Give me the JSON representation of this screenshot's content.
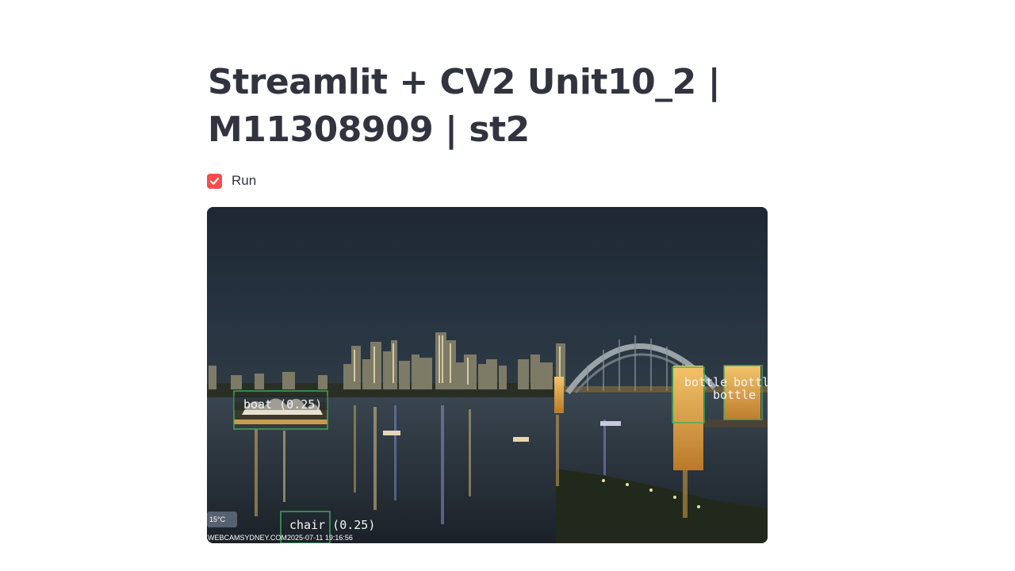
{
  "page": {
    "title": "Streamlit + CV2 Unit10_2 | M11308909 | st2"
  },
  "run_checkbox": {
    "label": "Run",
    "checked": true,
    "accent_color": "#ff4b4b"
  },
  "video": {
    "scene": "Sydney Harbour at night",
    "detections": [
      {
        "label": "boat (0.25)"
      },
      {
        "label": "chair (0.25)"
      },
      {
        "label": "bottle"
      },
      {
        "label": "bottle"
      },
      {
        "label": "bottle"
      }
    ],
    "box_color": "#3fae5a",
    "watermark": {
      "weather": "15°C",
      "source": "WEBCAMSYDNEY.COM",
      "timestamp": "2025-07-11 19:16:56"
    }
  }
}
